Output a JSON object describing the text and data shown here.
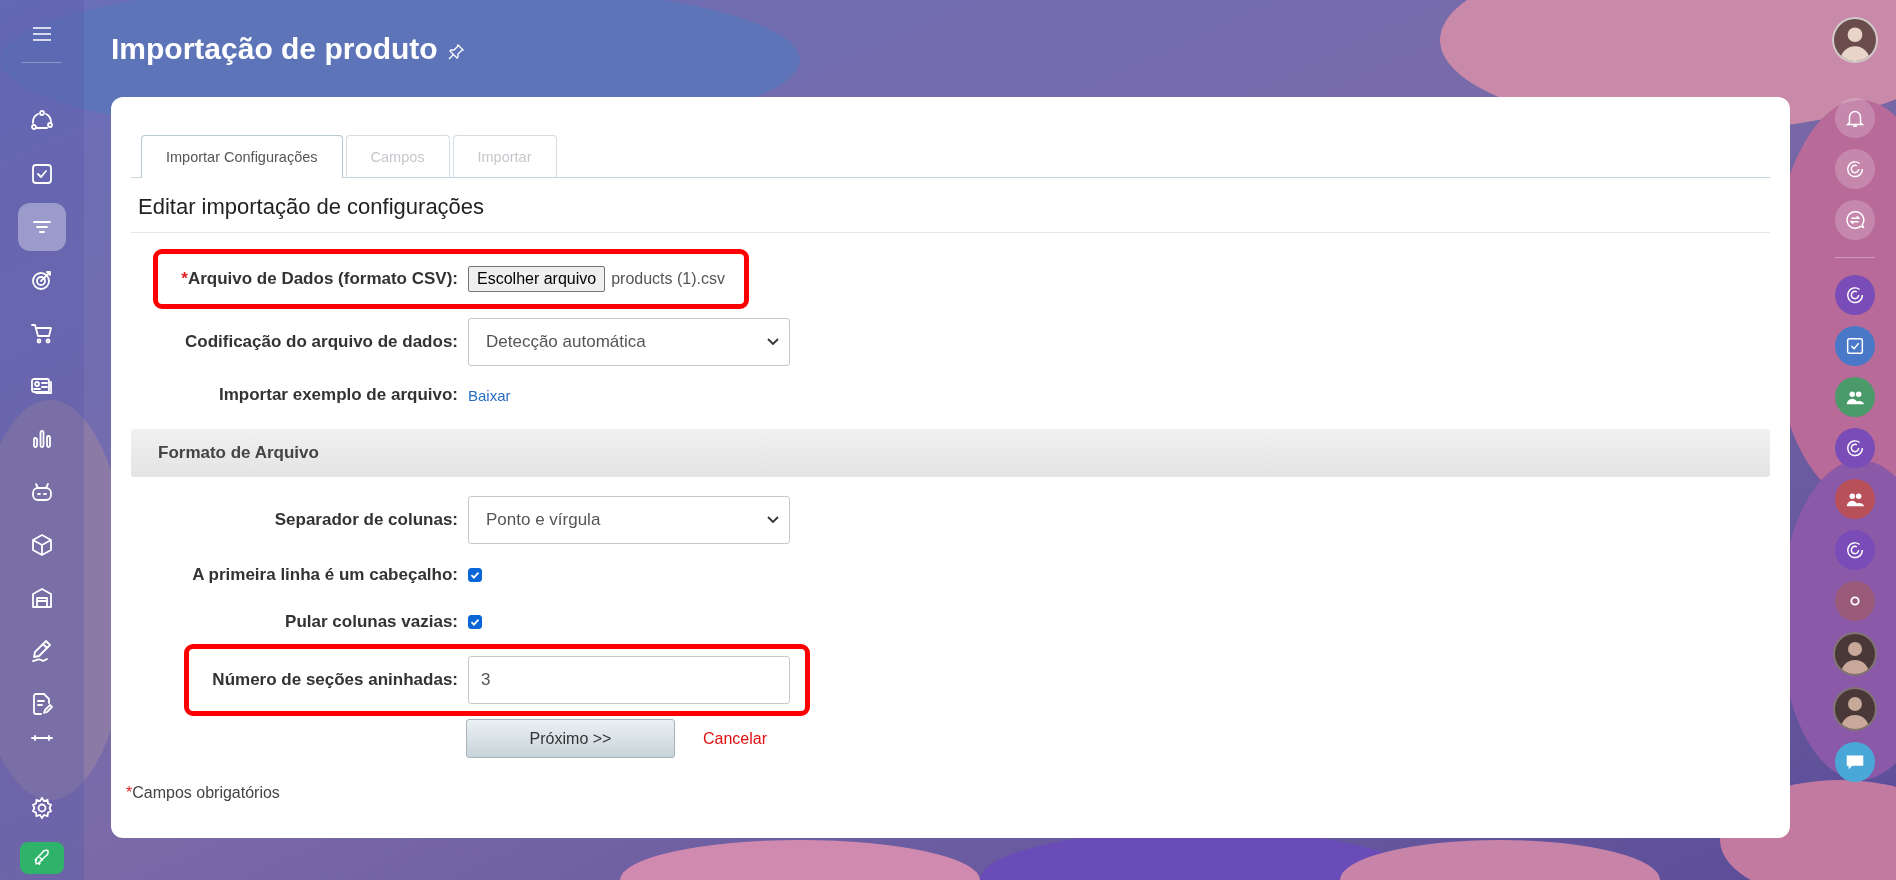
{
  "page_title": "Importação de produto",
  "sidebar": {
    "items": [
      {
        "selected": false
      },
      {
        "selected": false
      },
      {
        "selected": true
      },
      {
        "selected": false
      },
      {
        "selected": false
      },
      {
        "selected": false
      },
      {
        "selected": false
      },
      {
        "selected": false
      },
      {
        "selected": false
      },
      {
        "selected": false
      },
      {
        "selected": false
      },
      {
        "selected": false
      },
      {
        "selected": false
      }
    ]
  },
  "tabs": [
    {
      "label": "Importar Configurações",
      "selected": true,
      "disabled": false
    },
    {
      "label": "Campos",
      "selected": false,
      "disabled": true
    },
    {
      "label": "Importar",
      "selected": false,
      "disabled": true
    }
  ],
  "heading": "Editar importação de configurações",
  "fields": [
    {
      "kind": "file",
      "mark": "*",
      "label": "Arquivo de Dados (formato CSV):",
      "button": "Escolher arquivo",
      "value": "products (1).csv",
      "highlighted": true
    },
    {
      "kind": "select",
      "label": "Codificação do arquivo de dados:",
      "value": "Detecção automática",
      "highlighted": false
    },
    {
      "kind": "link",
      "label": "Importar exemplo de arquivo:",
      "link": "Baixar",
      "highlighted": false
    }
  ],
  "section": {
    "title": "Formato de Arquivo",
    "fields": [
      {
        "kind": "select",
        "label": "Separador de colunas:",
        "value": "Ponto e vírgula",
        "highlighted": false
      },
      {
        "kind": "checkbox",
        "label": "A primeira linha é um cabeçalho:",
        "checked": true,
        "highlighted": false
      },
      {
        "kind": "checkbox",
        "label": "Pular colunas vazias:",
        "checked": true,
        "highlighted": false
      },
      {
        "kind": "input",
        "label": "Número de seções aninhadas:",
        "value": "3",
        "highlighted": true
      }
    ]
  },
  "actions": {
    "primary": "Próximo >>",
    "cancel": "Cancelar"
  },
  "footnote": {
    "mark": "*",
    "text": "Campos obrigatórios"
  }
}
